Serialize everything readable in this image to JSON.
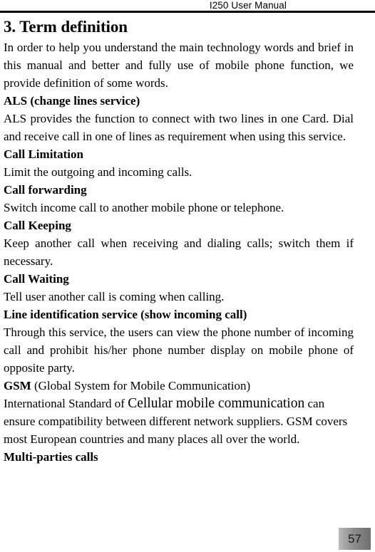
{
  "header": {
    "running_head": "I250 User Manual"
  },
  "document": {
    "section_title": "3. Term definition",
    "intro_paragraph": "In order to help you understand the main technology words and brief in this manual and better and fully use of mobile phone function, we provide definition of some words.",
    "entries": [
      {
        "term": "ALS (change lines service)",
        "definition": "ALS provides the function to connect with two lines in one Card. Dial and receive call in one of lines as requirement when using this service."
      },
      {
        "term": "Call Limitation",
        "definition": "Limit the outgoing and incoming calls."
      },
      {
        "term": "Call forwarding",
        "definition": "Switch income call to another mobile phone or telephone."
      },
      {
        "term": "Call Keeping",
        "definition": "Keep another call when receiving and dialing calls; switch them if necessary."
      },
      {
        "term": "Call Waiting",
        "definition": "Tell user another call is coming when calling."
      },
      {
        "term": "Line identification service (show incoming call)",
        "definition": "Through this service, the users can view the phone number of incoming call and prohibit his/her phone number display on mobile phone of opposite party."
      }
    ],
    "gsm_entry": {
      "term_bold": "GSM",
      "term_expansion": " (Global System for Mobile Communication)",
      "definition_lead": "International Standard of ",
      "definition_emphasis": "Cellular mobile communication",
      "definition_tail": " can ensure compatibility between different network suppliers. GSM covers most European countries and many places all over the world."
    },
    "final_term": "Multi-parties calls"
  },
  "footer": {
    "page_number": "57"
  }
}
